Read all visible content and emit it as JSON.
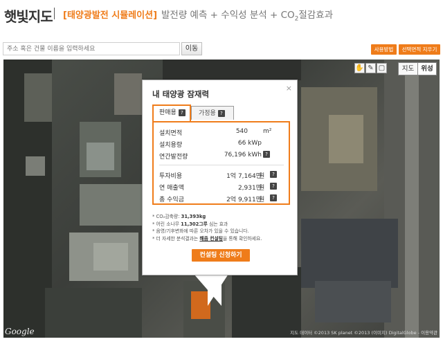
{
  "header": {
    "logo": "햇빛지도",
    "sim_title": "[태양광발전 시뮬레이션]",
    "subtitle_main": "발전량 예측 + 수익성 분석 + CO",
    "subtitle_sub": "2",
    "subtitle_tail": "절감효과"
  },
  "search": {
    "placeholder": "주소 혹은 건물 이름을 입력하세요",
    "button": "이동"
  },
  "actions": {
    "help": "사용방법",
    "clear": "선택면적 지우기"
  },
  "map": {
    "type_map": "지도",
    "type_satellite": "위성",
    "google": "Google",
    "copyright": "지도 데이터 ©2013 SK planet ©2013 (이미지) DigitalGlobe - 이용약관"
  },
  "popup": {
    "title": "내 태양광 잠재력",
    "close": "×",
    "tab_business": "판매용",
    "tab_home": "가정용",
    "help_mark": "?",
    "rows": [
      {
        "label": "설치면적",
        "value": "540",
        "unit": "m²"
      },
      {
        "label": "설치용량",
        "value": "66 kWp",
        "unit": ""
      },
      {
        "label": "연간발전량",
        "value": "76,196 kWh",
        "unit": "?"
      }
    ],
    "money_rows": [
      {
        "label": "투자비용",
        "value": "1억 7,164만",
        "unit": "원"
      },
      {
        "label": "연 매출액",
        "value": "2,931만",
        "unit": "원"
      },
      {
        "label": "총 수익금",
        "value": "2억 9,911만",
        "unit": "원"
      }
    ],
    "notes": {
      "co2_prefix": "* CO₂감축량: ",
      "co2_value": "31,393kg",
      "tree_prefix": "* 어린 소나무 ",
      "tree_value": "11,302그루",
      "tree_suffix": " 심는 효과",
      "note3": "* 음영/기후변화에 따른 오차가 있을 수 있습니다.",
      "note4_prefix": "* 더 자세한 분석결과는 ",
      "note4_link": "해줌 컨설팅",
      "note4_suffix": "을 통해 확인하세요."
    },
    "consult_button": "컨설팅 신청하기"
  },
  "colors": {
    "accent": "#ef7c1a"
  }
}
